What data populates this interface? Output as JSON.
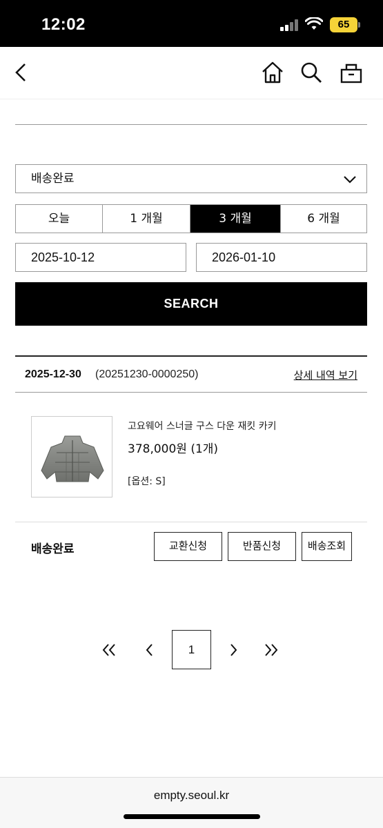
{
  "status_bar": {
    "time": "12:02",
    "battery": "65"
  },
  "header": {
    "back_icon": "chevron-left-icon",
    "home_icon": "home-icon",
    "search_icon": "search-icon",
    "cart_icon": "cart-icon"
  },
  "filter": {
    "status_selected": "배송완료",
    "periods": [
      {
        "label": "오늘",
        "active": false
      },
      {
        "label": "1 개월",
        "active": false
      },
      {
        "label": "3 개월",
        "active": true
      },
      {
        "label": "6 개월",
        "active": false
      }
    ],
    "date_from": "2025-10-12",
    "date_to": "2026-01-10",
    "search_label": "SEARCH"
  },
  "order": {
    "date": "2025-12-30",
    "order_no": "(20251230-0000250)",
    "detail_link": "상세 내역 보기",
    "product": {
      "name": "고요웨어 스너글 구스 다운 재킷 카키",
      "price": "378,000원 (1개)",
      "option": "[옵션: S]"
    },
    "status": "배송완료",
    "actions": [
      "교환신청",
      "반품신청",
      "배송조회"
    ]
  },
  "pagination": {
    "current": "1"
  },
  "browser": {
    "url": "empty.seoul.kr"
  },
  "colors": {
    "accent": "#000000",
    "battery": "#f5d338"
  }
}
